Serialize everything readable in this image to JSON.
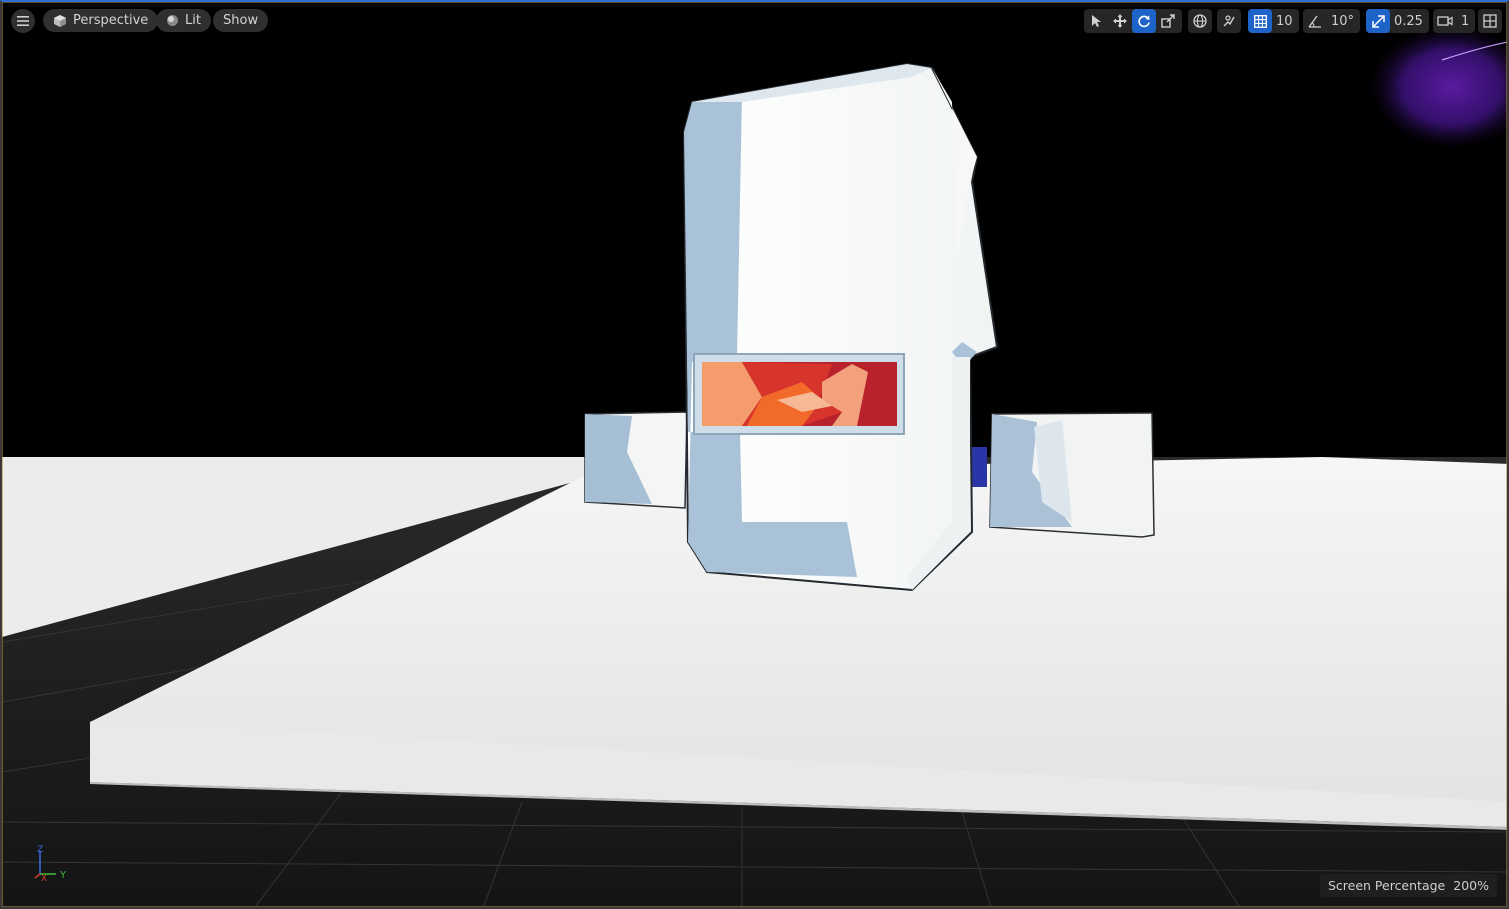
{
  "toolbar": {
    "view_mode": "Perspective",
    "lit": "Lit",
    "show": "Show",
    "grid_snap": "10",
    "rotation_snap": "10°",
    "scale_snap": "0.25",
    "camera_speed": "1"
  },
  "overlay": {
    "screen_percentage_label": "Screen Percentage",
    "screen_percentage_value": "200%"
  },
  "axis": {
    "z": "Z",
    "x": "X",
    "y": "Y"
  },
  "colors": {
    "accent": "#1e64c8",
    "axis_x": "#d33a2c",
    "axis_y": "#3fbf3f",
    "axis_z": "#3a6fe0"
  }
}
